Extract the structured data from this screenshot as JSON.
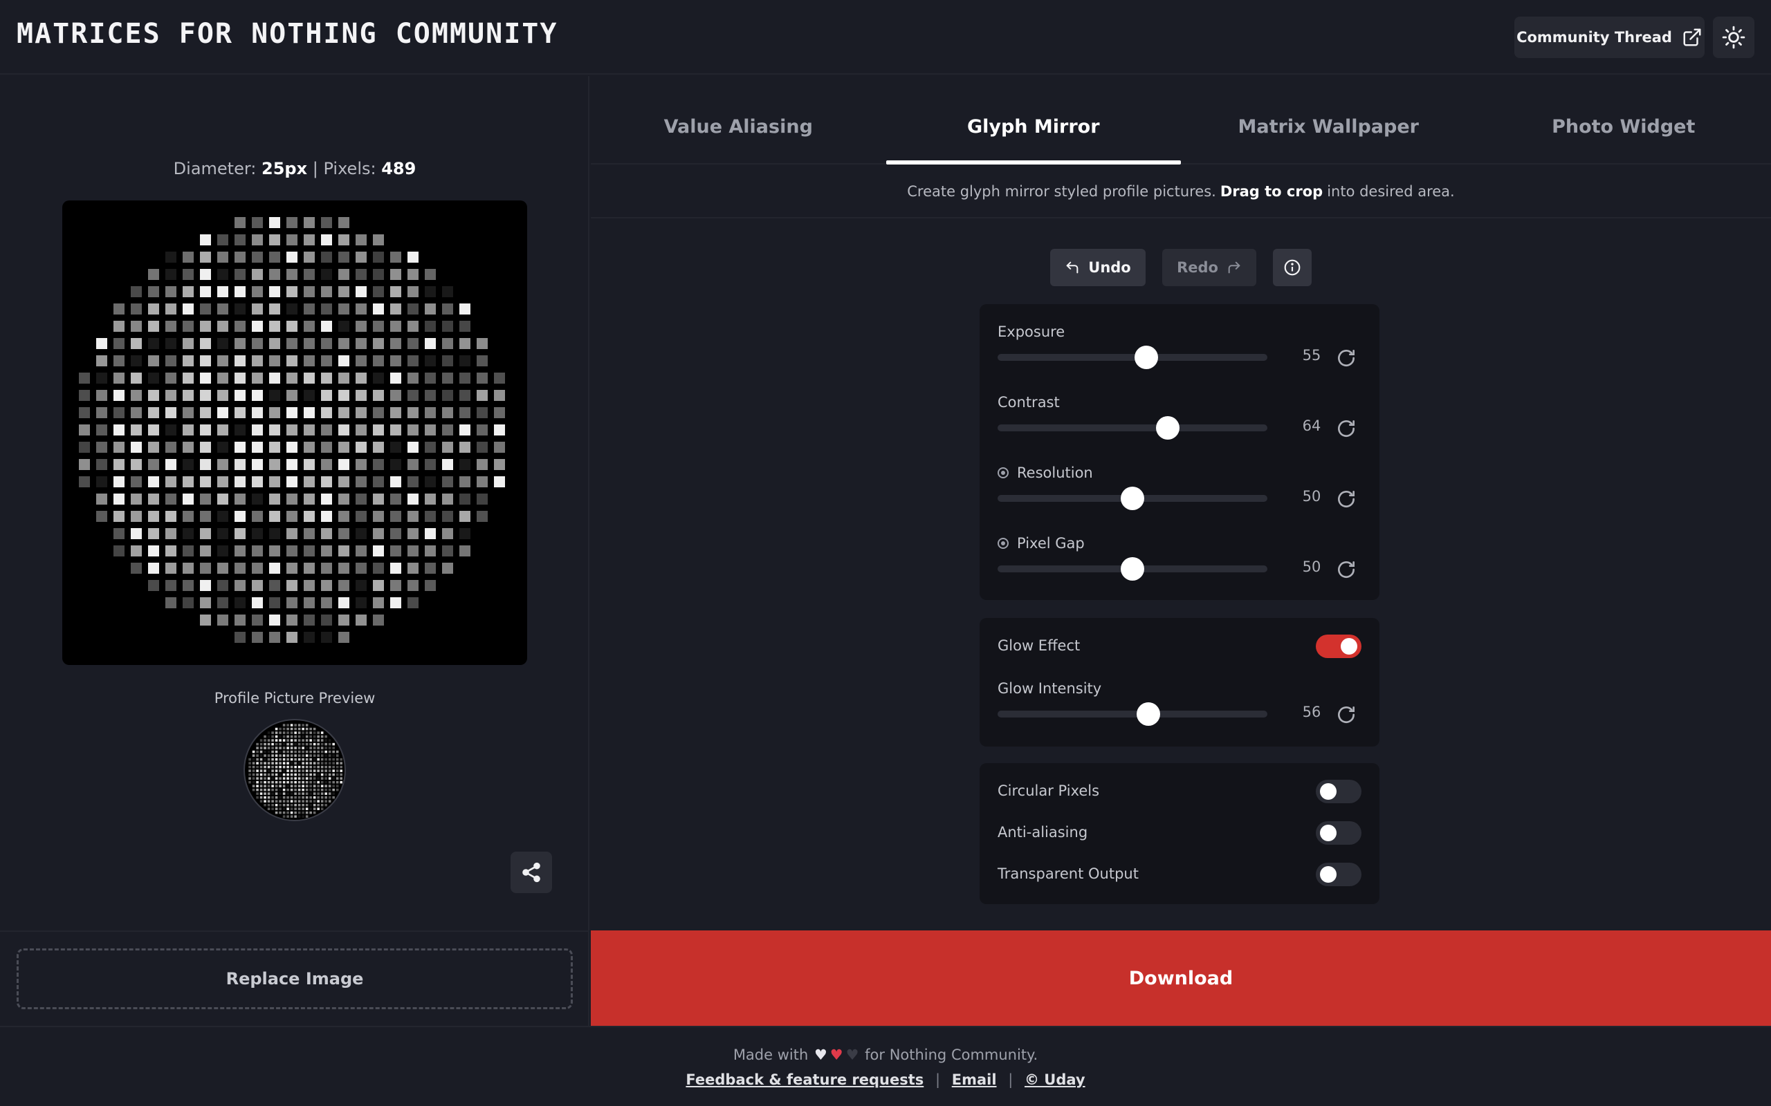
{
  "header": {
    "logo": "MATRICES FOR NOTHING COMMUNITY",
    "community_label": "Community Thread",
    "icons": [
      "external-link-icon",
      "sun-icon"
    ]
  },
  "left": {
    "diameter_label": "Diameter:",
    "diameter_value": "25px",
    "separator": "|",
    "pixels_label": "Pixels:",
    "pixels_value": "489",
    "preview_label": "Profile Picture Preview",
    "replace_label": "Replace Image"
  },
  "tabs": [
    {
      "label": "Value Aliasing",
      "active": false
    },
    {
      "label": "Glyph Mirror",
      "active": true
    },
    {
      "label": "Matrix Wallpaper",
      "active": false
    },
    {
      "label": "Photo Widget",
      "active": false
    }
  ],
  "tagline": {
    "pre": "Create glyph mirror styled profile pictures.",
    "bold": "Drag to crop",
    "post": "into desired area."
  },
  "actions": {
    "undo": "Undo",
    "redo": "Redo"
  },
  "sliders": [
    {
      "label": "Exposure",
      "value": "55",
      "radio": false
    },
    {
      "label": "Contrast",
      "value": "64",
      "radio": false
    },
    {
      "label": "Resolution",
      "value": "50",
      "radio": true
    },
    {
      "label": "Pixel Gap",
      "value": "50",
      "radio": true
    }
  ],
  "glow": {
    "toggle_label": "Glow Effect",
    "toggle_on": true,
    "intensity_label": "Glow Intensity",
    "intensity_value": "56"
  },
  "options": [
    {
      "label": "Circular Pixels",
      "on": false
    },
    {
      "label": "Anti-aliasing",
      "on": false
    },
    {
      "label": "Transparent Output",
      "on": false
    }
  ],
  "download_label": "Download",
  "footer": {
    "made_with": "Made with",
    "for_text": "for Nothing Community.",
    "links": [
      "Feedback & feature requests",
      "Email",
      "© Uday"
    ],
    "link_sep": "|"
  },
  "colors": {
    "accent": "#c7302b",
    "background": "#1a1c25",
    "card": "#121319"
  }
}
